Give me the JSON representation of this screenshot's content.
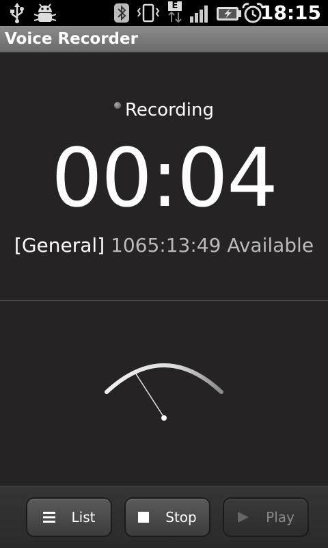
{
  "status_bar": {
    "time": "18:15",
    "network": "E"
  },
  "app": {
    "title": "Voice Recorder"
  },
  "recorder": {
    "state": "Recording",
    "elapsed": "00:04",
    "storage_label": "[General]",
    "available_time": "1065:13:49",
    "available_label": "Available"
  },
  "buttons": {
    "list": "List",
    "stop": "Stop",
    "play": "Play"
  }
}
